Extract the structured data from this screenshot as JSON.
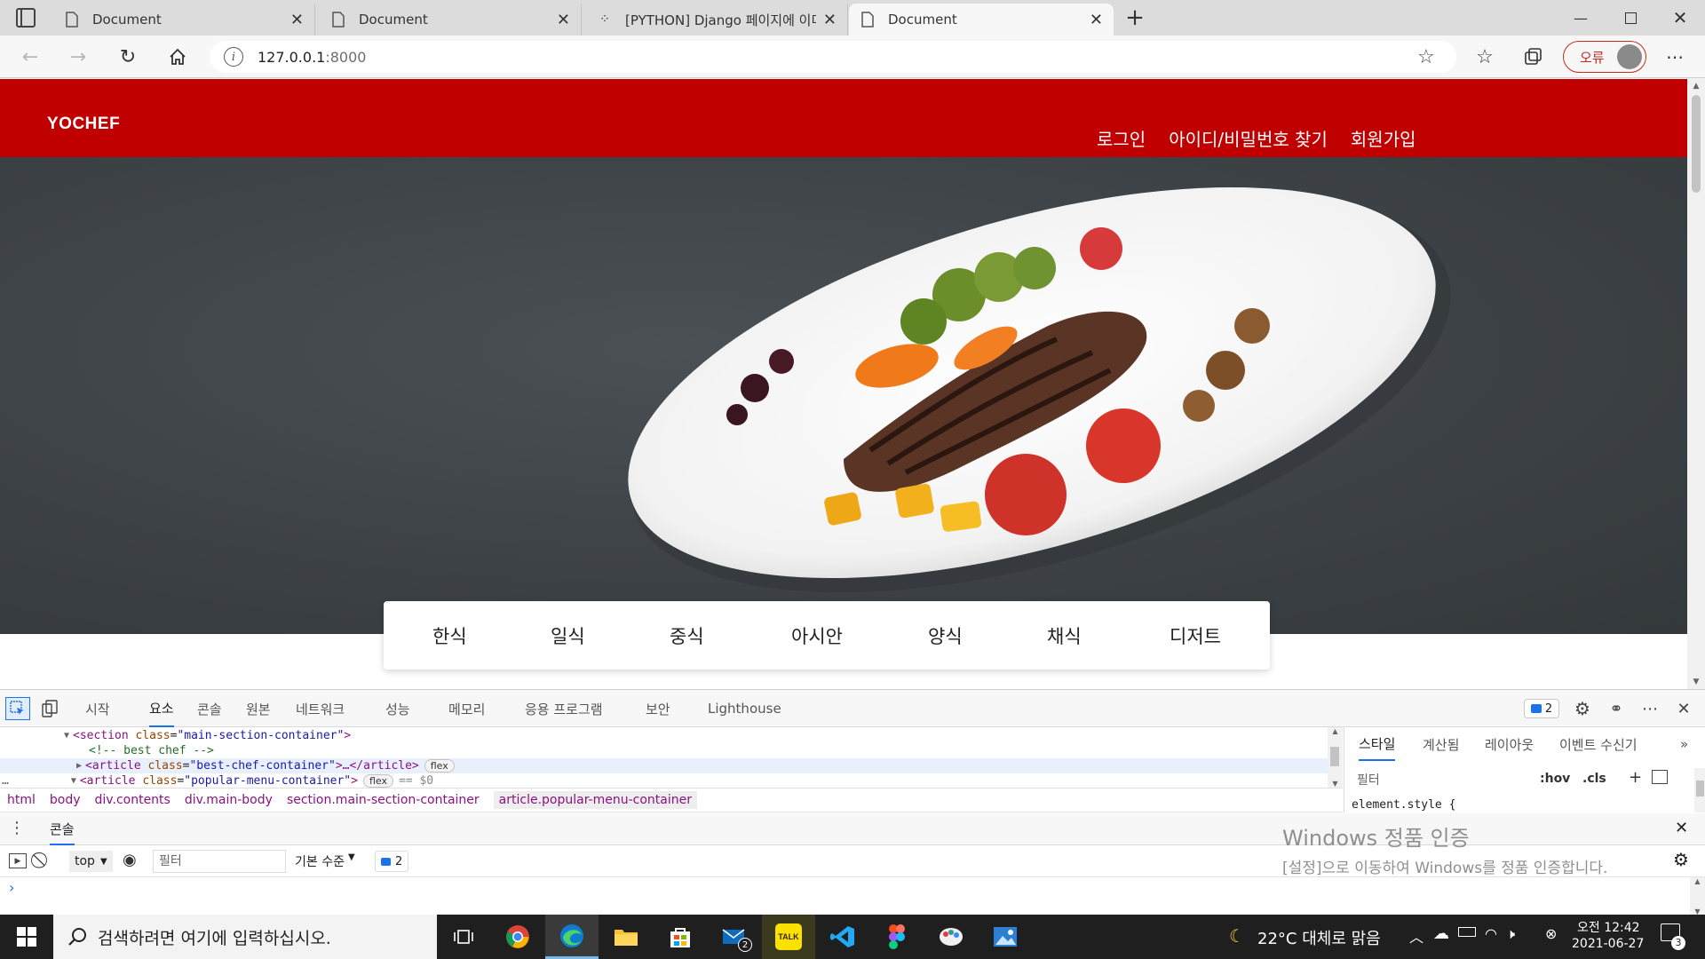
{
  "browser": {
    "tabs": [
      {
        "title": "Document",
        "active": false,
        "icon": "page-icon"
      },
      {
        "title": "Document",
        "active": false,
        "icon": "page-icon"
      },
      {
        "title": "[PYTHON] Django 페이지에 이미",
        "active": false,
        "icon": "velog-dots-icon"
      },
      {
        "title": "Document",
        "active": true,
        "icon": "page-icon"
      }
    ],
    "url_host": "127.0.0.1",
    "url_port": ":8000",
    "profile_label": "오류"
  },
  "site": {
    "logo": "YOCHEF",
    "nav": [
      "로그인",
      "아이디/비밀번호 찾기",
      "회원가입"
    ],
    "categories": [
      "한식",
      "일식",
      "중식",
      "아시안",
      "양식",
      "채식",
      "디저트"
    ],
    "brand_color": "#c00000"
  },
  "devtools": {
    "tabs": [
      "시작",
      "요소",
      "콘솔",
      "원본",
      "네트워크",
      "성능",
      "메모리",
      "응용 프로그램",
      "보안",
      "Lighthouse"
    ],
    "active_tab": "요소",
    "issues_count": "2",
    "elements": {
      "line1_tag": "<section",
      "line1_attr": "class",
      "line1_val": "\"main-section-container\"",
      "line1_end": ">",
      "line2_comment": "<!-- best chef -->",
      "line3_tag": "<article",
      "line3_attr": "class",
      "line3_val": "\"best-chef-container\"",
      "line3_end": ">…</article>",
      "line3_badge": "flex",
      "line4_tag": "<article",
      "line4_attr": "class",
      "line4_val": "\"popular-menu-container\"",
      "line4_end": ">",
      "line4_badge": "flex",
      "line4_suffix": "== $0"
    },
    "breadcrumb": [
      "html",
      "body",
      "div.contents",
      "div.main-body",
      "section.main-section-container",
      "article.popular-menu-container"
    ],
    "styles_tabs": [
      "스타일",
      "계산됨",
      "레이아웃",
      "이벤트 수신기"
    ],
    "styles_filter_placeholder": "필터",
    "styles_hov": ":hov",
    "styles_cls": ".cls",
    "element_style": "element.style {",
    "drawer_tab": "콘솔",
    "console_context": "top",
    "console_filter_placeholder": "필터",
    "console_level": "기본 수준",
    "console_issues": "2",
    "prompt": "›"
  },
  "watermark": {
    "line1": "Windows 정품 인증",
    "line2": "[설정]으로 이동하여 Windows를 정품 인증합니다."
  },
  "taskbar": {
    "search_placeholder": "검색하려면 여기에 입력하십시오.",
    "apps": [
      "task-view-icon",
      "chrome-icon",
      "edge-icon",
      "file-explorer-icon",
      "store-icon",
      "mail-icon",
      "kakaotalk-icon",
      "vscode-icon",
      "figma-icon",
      "paint-icon",
      "photos-icon"
    ],
    "mail_badge": "2",
    "kakao_label": "TALK",
    "weather": "22°C 대체로 맑음",
    "time": "오전 12:42",
    "date": "2021-06-27",
    "notif_count": "3"
  }
}
